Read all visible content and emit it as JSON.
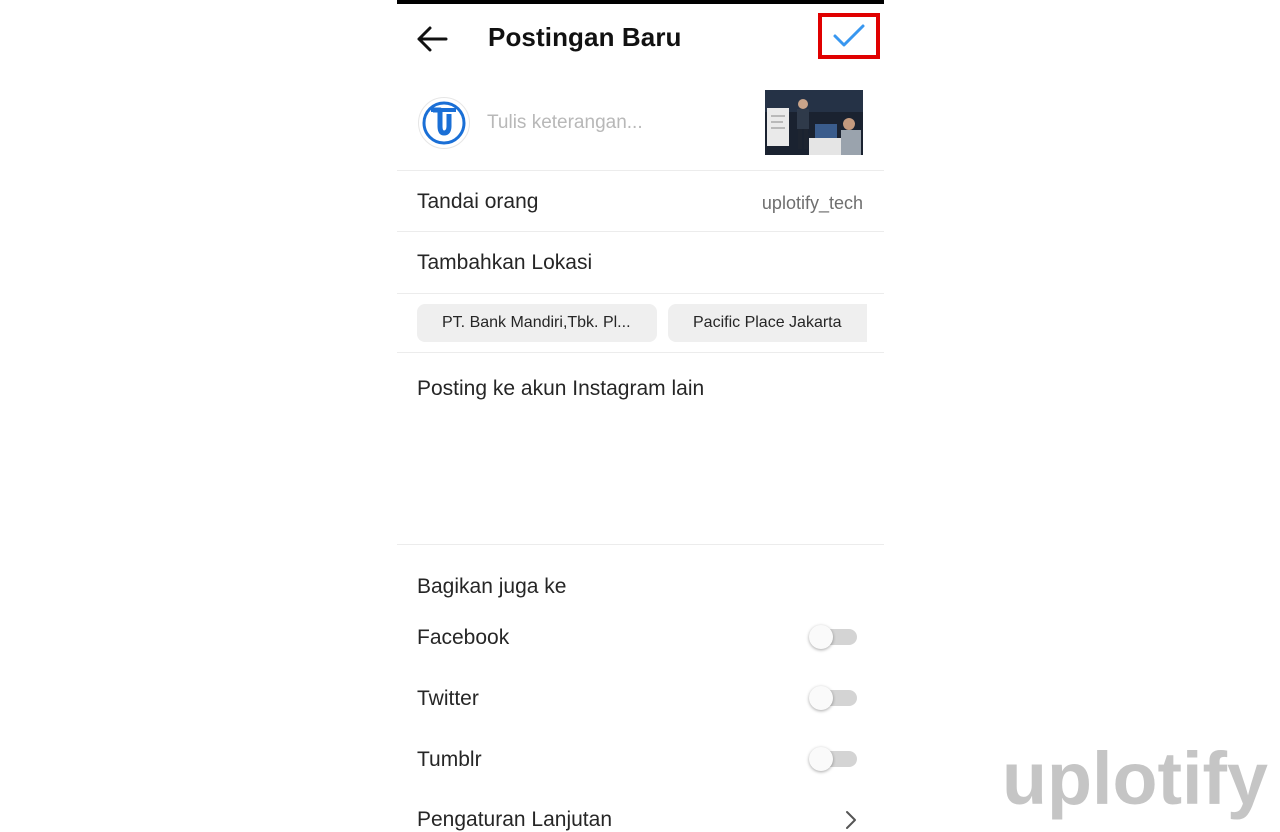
{
  "header": {
    "title": "Postingan Baru",
    "back_icon": "arrow-left-icon",
    "confirm_icon": "checkmark-icon"
  },
  "caption": {
    "placeholder": "Tulis keterangan...",
    "value": ""
  },
  "tag_people": {
    "label": "Tandai orang",
    "value": "uplotify_tech"
  },
  "location": {
    "label": "Tambahkan Lokasi",
    "suggestions": [
      "PT. Bank Mandiri,Tbk. Pl...",
      "Pacific Place Jakarta"
    ]
  },
  "post_other": {
    "label": "Posting ke akun Instagram lain"
  },
  "share": {
    "heading": "Bagikan juga ke",
    "items": [
      {
        "label": "Facebook",
        "enabled": false
      },
      {
        "label": "Twitter",
        "enabled": false
      },
      {
        "label": "Tumblr",
        "enabled": false
      }
    ]
  },
  "advanced": {
    "label": "Pengaturan Lanjutan"
  },
  "watermark": {
    "text": "uplotify"
  },
  "colors": {
    "confirm_check": "#3897f0",
    "highlight_box": "#e00000",
    "logo_blue": "#1a6fd6",
    "watermark": "#c5c5c5"
  }
}
